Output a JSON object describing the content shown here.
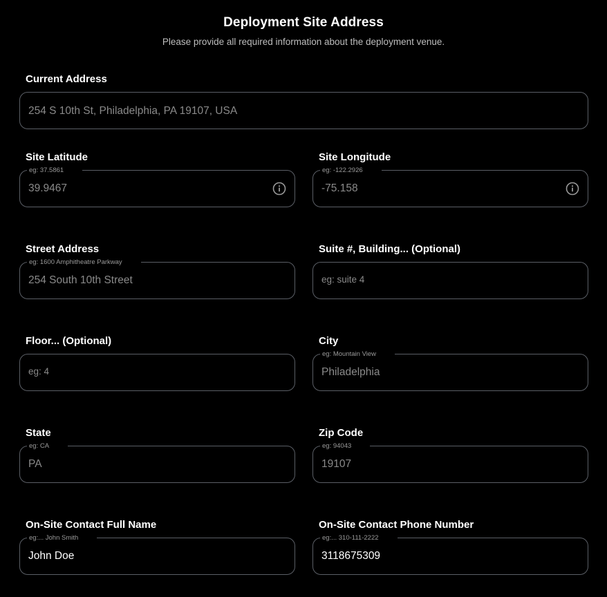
{
  "header": {
    "title": "Deployment Site Address",
    "subtitle": "Please provide all required information about the deployment venue."
  },
  "fields": {
    "current_address": {
      "label": "Current Address",
      "value": "254 S 10th St, Philadelphia, PA 19107, USA"
    },
    "latitude": {
      "label": "Site Latitude",
      "hint": "eg: 37.5861",
      "value": "39.9467",
      "icon": "info-icon"
    },
    "longitude": {
      "label": "Site Longitude",
      "hint": "eg: -122.2926",
      "value": "-75.158",
      "icon": "info-icon"
    },
    "street": {
      "label": "Street Address",
      "hint": "eg: 1600 Amphitheatre Parkway",
      "value": "254 South 10th Street"
    },
    "suite": {
      "label": "Suite #, Building... (Optional)",
      "placeholder": "eg: suite 4"
    },
    "floor": {
      "label": "Floor... (Optional)",
      "placeholder": "eg: 4"
    },
    "city": {
      "label": "City",
      "hint": "eg: Mountain View",
      "value": "Philadelphia"
    },
    "state": {
      "label": "State",
      "hint": "eg: CA",
      "value": "PA"
    },
    "zip": {
      "label": "Zip Code",
      "hint": "eg: 94043",
      "value": "19107"
    },
    "contact_name": {
      "label": "On-Site Contact Full Name",
      "hint": "eg:... John Smith",
      "value": "John Doe"
    },
    "contact_phone": {
      "label": "On-Site Contact Phone Number",
      "hint": "eg:... 310-111-2222",
      "value": "3118675309"
    }
  },
  "colors": {
    "background": "#000000",
    "border": "#5b5f66",
    "muted_text": "#8a8a8a",
    "text": "#ffffff"
  }
}
